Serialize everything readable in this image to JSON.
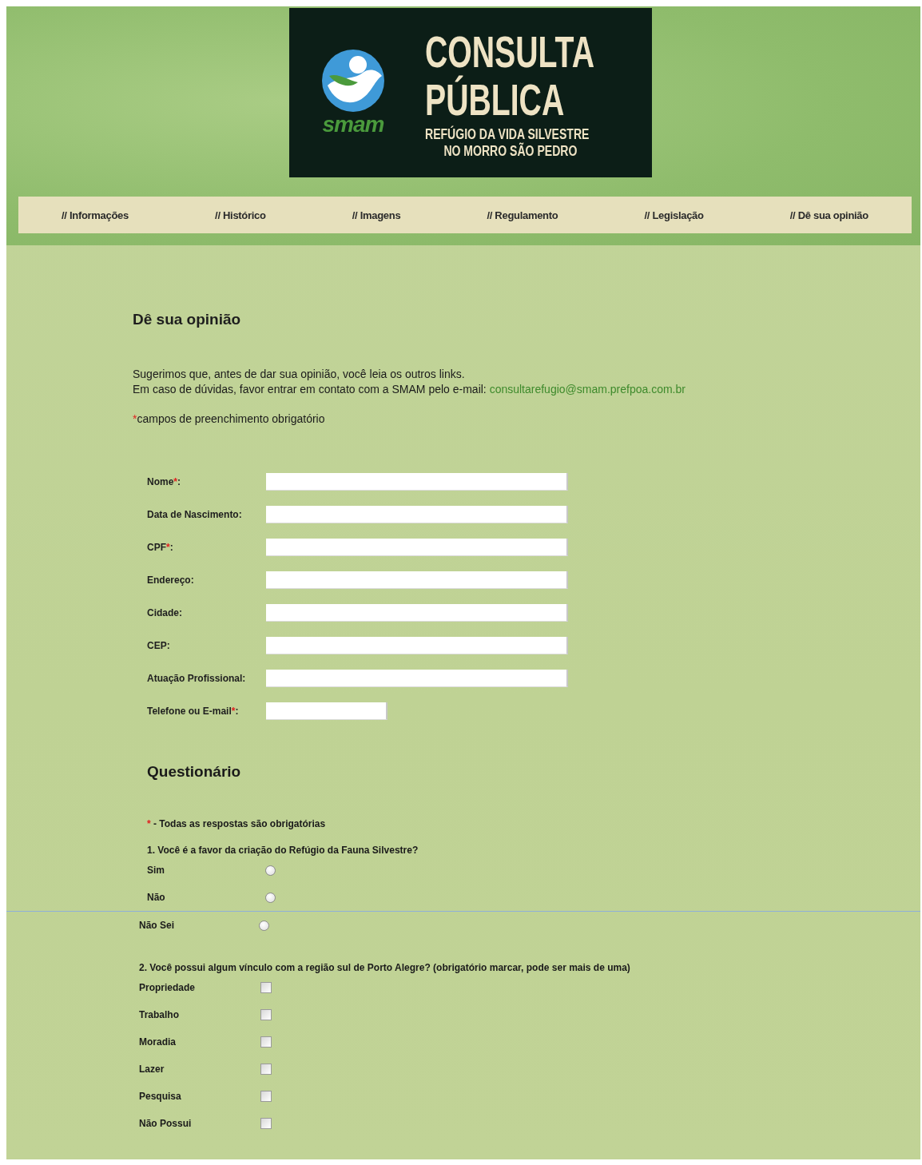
{
  "logo": {
    "brand": "smam",
    "title_lines": [
      "CONSULTA",
      "PÚBLICA"
    ],
    "subtitle_lines": [
      "REFÚGIO DA VIDA SILVESTRE",
      "NO MORRO SÃO PEDRO"
    ]
  },
  "nav": [
    {
      "label": "// Informações",
      "selected": false
    },
    {
      "label": "// Histórico",
      "selected": false
    },
    {
      "label": "// Imagens",
      "selected": false
    },
    {
      "label": "// Regulamento",
      "selected": false
    },
    {
      "label": "// Legislação",
      "selected": false
    },
    {
      "label": "// Dê sua opinião",
      "selected": false
    }
  ],
  "heading": "Dê sua opinião",
  "intro": [
    "Sugerimos que, antes de dar sua opinião, você leia os outros links.",
    "Em caso de dúvidas, favor entrar em contato com a SMAM pelo e-mail:"
  ],
  "email": "consultarefugio@smam.prefpoa.com.br",
  "required_note": {
    "mark": "*",
    "text": "campos de preenchimento obrigatório"
  },
  "fields": [
    {
      "label": "Nome",
      "mark": "*",
      "end": ":",
      "kind": "long"
    },
    {
      "label": "Data de Nascimento:",
      "kind": "long"
    },
    {
      "label": "CPF",
      "mark": "*",
      "end": ":",
      "kind": "long"
    },
    {
      "label": "Endereço:",
      "kind": "long"
    },
    {
      "label": "Cidade:",
      "kind": "long"
    },
    {
      "label": "CEP:",
      "kind": "long"
    },
    {
      "label": "Atuação Profissional:",
      "kind": "long"
    },
    {
      "label": "Telefone ou E-mail",
      "mark": "*",
      "end": ":",
      "kind": "short"
    }
  ],
  "questionnaire": {
    "title": "Questionário",
    "note_mark": "*",
    "note": " - Todas as respostas são obrigatórias",
    "q1": {
      "text": "1. Você é a favor da criação do Refúgio da Fauna Silvestre?",
      "options": [
        {
          "label": "Sim",
          "selected": false
        },
        {
          "label": "Não",
          "selected": false
        }
      ]
    },
    "q1_after_break": [
      {
        "label": "Não Sei",
        "selected": false
      }
    ],
    "q2": {
      "text": "2. Você possui algum vínculo com a região sul de Porto Alegre? (obrigatório marcar, pode ser mais de uma)",
      "options": [
        {
          "label": "Propriedade",
          "checked": false
        },
        {
          "label": "Trabalho",
          "checked": false
        },
        {
          "label": "Moradia",
          "checked": false
        },
        {
          "label": "Lazer",
          "checked": false
        },
        {
          "label": "Pesquisa",
          "checked": false
        },
        {
          "label": "Não Possui",
          "checked": false
        }
      ]
    }
  }
}
